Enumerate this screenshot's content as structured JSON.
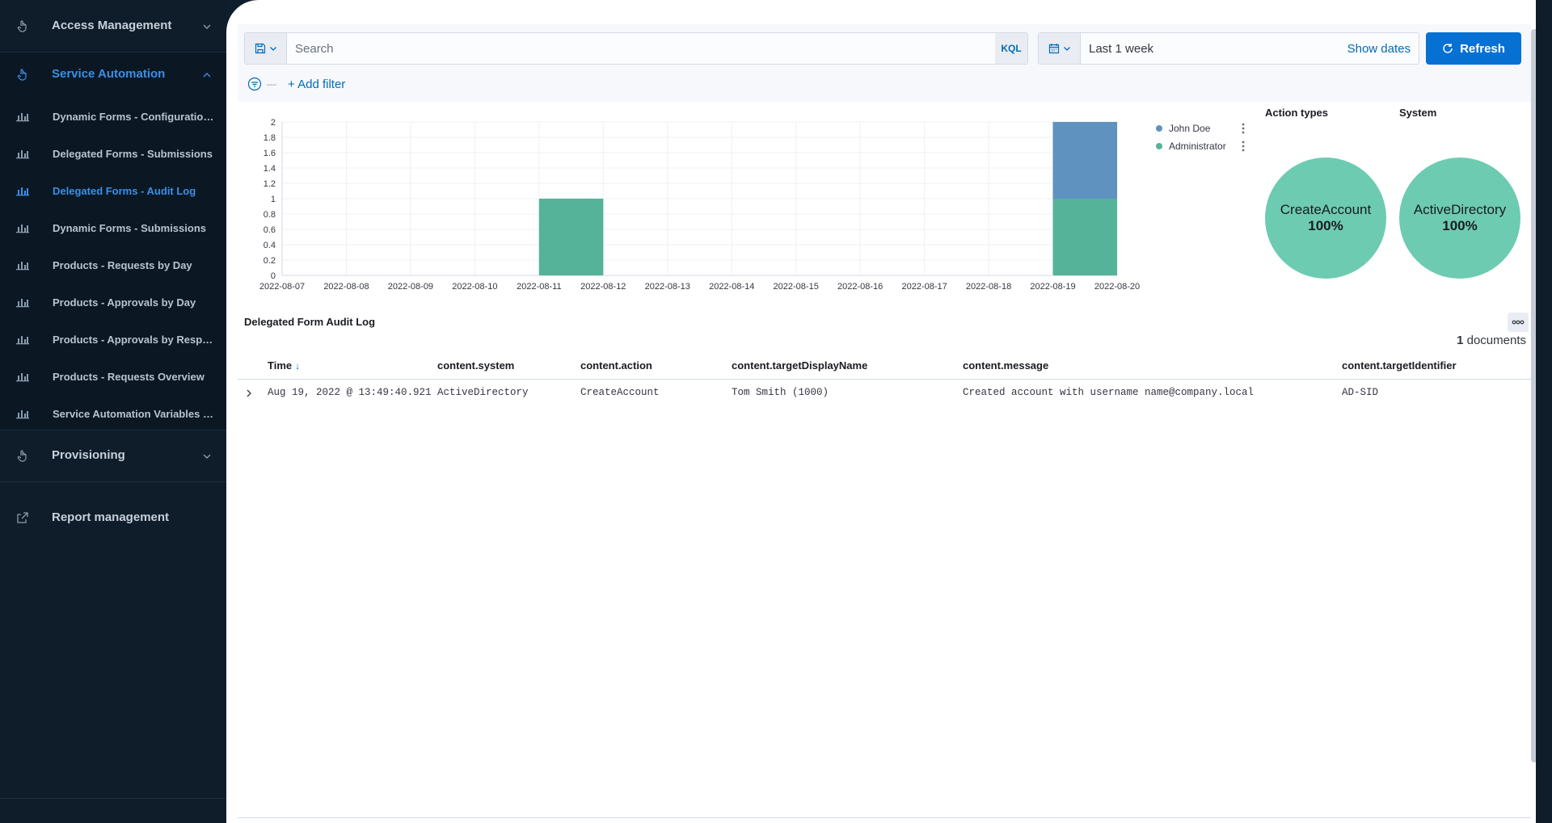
{
  "sidebar": {
    "sections": [
      {
        "label": "Access Management",
        "expanded": false
      },
      {
        "label": "Service Automation",
        "expanded": true
      },
      {
        "label": "Provisioning",
        "expanded": false
      },
      {
        "label": "Report management",
        "icon": "external-link-icon"
      }
    ],
    "items": [
      {
        "label": "Dynamic Forms - Configuration..."
      },
      {
        "label": "Delegated Forms - Submissions"
      },
      {
        "label": "Delegated Forms - Audit Log",
        "active": true
      },
      {
        "label": "Dynamic Forms - Submissions"
      },
      {
        "label": "Products - Requests by Day"
      },
      {
        "label": "Products - Approvals by Day"
      },
      {
        "label": "Products - Approvals by Respo..."
      },
      {
        "label": "Products - Requests Overview"
      },
      {
        "label": "Service Automation Variables -..."
      }
    ]
  },
  "query": {
    "search_placeholder": "Search",
    "language": "KQL",
    "date_range": "Last 1 week",
    "show_dates": "Show dates",
    "refresh": "Refresh",
    "add_filter": "+ Add filter"
  },
  "chart_data": {
    "type": "bar",
    "stacked": true,
    "categories": [
      "2022-08-07",
      "2022-08-08",
      "2022-08-09",
      "2022-08-10",
      "2022-08-11",
      "2022-08-12",
      "2022-08-13",
      "2022-08-14",
      "2022-08-15",
      "2022-08-16",
      "2022-08-17",
      "2022-08-18",
      "2022-08-19",
      "2022-08-20"
    ],
    "y_ticks": [
      "0",
      "0.2",
      "0.4",
      "0.6",
      "0.8",
      "1",
      "1.2",
      "1.4",
      "1.6",
      "1.8",
      "2"
    ],
    "ylim": [
      0,
      2
    ],
    "bars": [
      {
        "start": "2022-08-11",
        "end": "2022-08-12",
        "series": "Administrator",
        "value": 1
      },
      {
        "start": "2022-08-19",
        "end": "2022-08-20",
        "series": "Administrator",
        "value": 1
      },
      {
        "start": "2022-08-19",
        "end": "2022-08-20",
        "series": "John Doe",
        "value": 1
      }
    ],
    "series": [
      {
        "name": "John Doe",
        "color": "#6092c0"
      },
      {
        "name": "Administrator",
        "color": "#54b399"
      }
    ],
    "legend_position": "right",
    "grid": true
  },
  "pies": [
    {
      "title": "Action types",
      "label": "CreateAccount",
      "percent": "100%",
      "color": "#6dcbb1"
    },
    {
      "title": "System",
      "label": "ActiveDirectory",
      "percent": "100%",
      "color": "#6dcbb1"
    }
  ],
  "table": {
    "title": "Delegated Form Audit Log",
    "doc_count": "1",
    "doc_label": "documents",
    "columns": [
      "Time",
      "content.system",
      "content.action",
      "content.targetDisplayName",
      "content.message",
      "content.targetIdentifier"
    ],
    "rows": [
      [
        "Aug 19, 2022 @ 13:49:40.921",
        "ActiveDirectory",
        "CreateAccount",
        "Tom Smith (1000)",
        "Created account with username name@company.local",
        "AD-SID"
      ]
    ]
  }
}
